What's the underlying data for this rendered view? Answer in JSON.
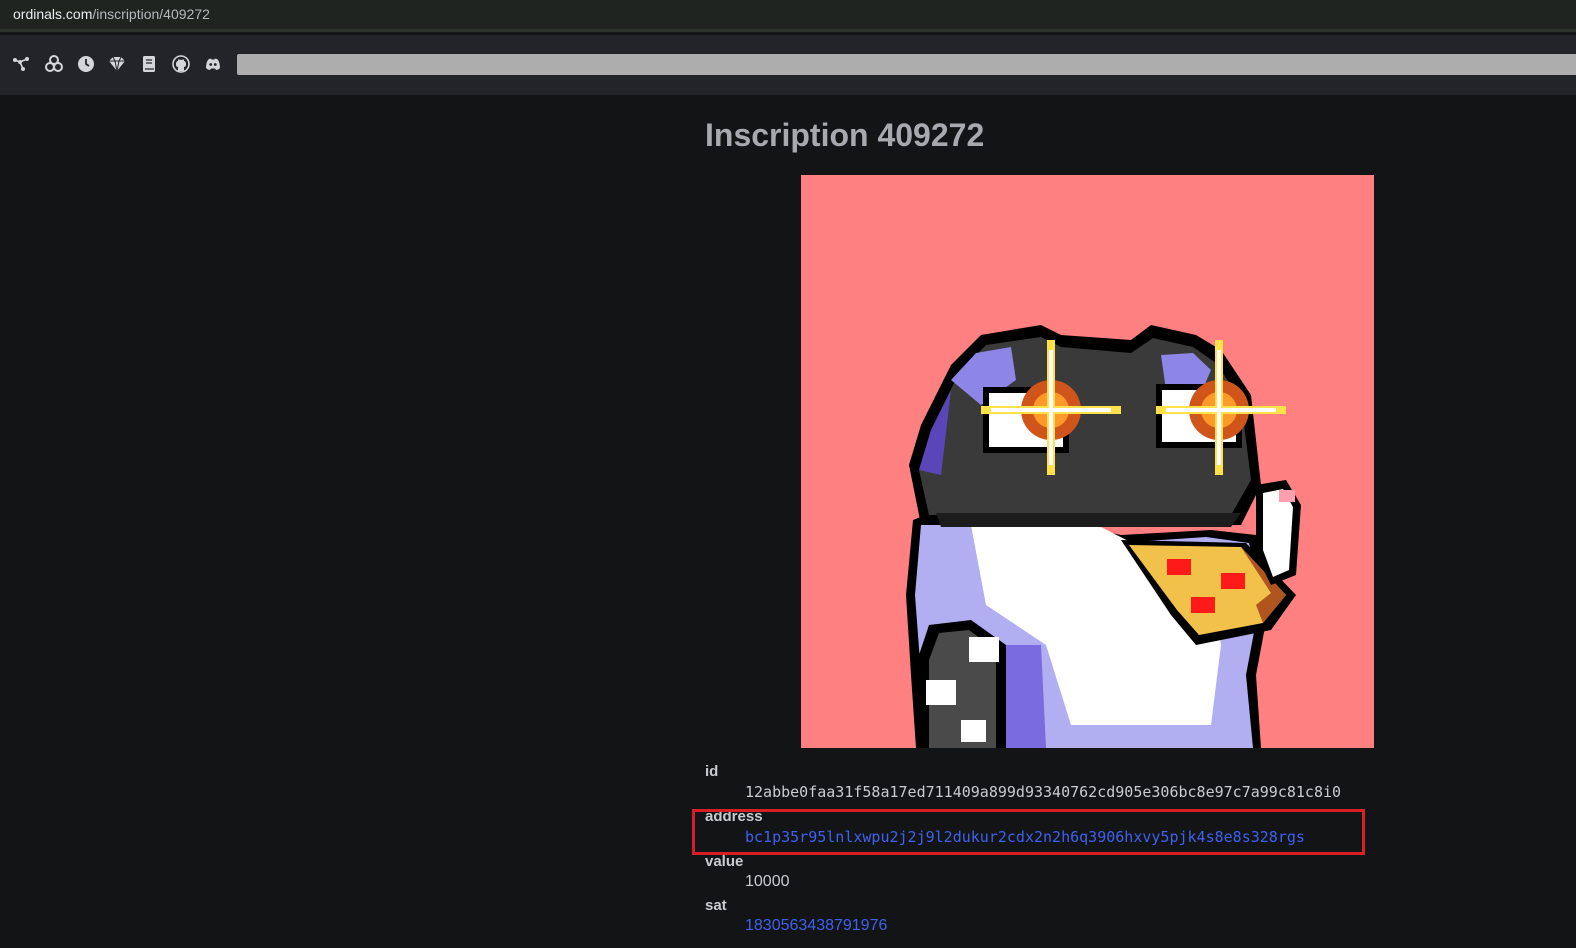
{
  "browser": {
    "url_host": "ordinals.com",
    "url_path": "/inscription/409272"
  },
  "nav": {
    "icons": [
      "blocks-icon",
      "rare-sats-icon",
      "clock-icon",
      "gem-icon",
      "book-icon",
      "github-icon",
      "discord-icon"
    ],
    "search_placeholder": ""
  },
  "page": {
    "title": "Inscription 409272",
    "preview_background": "#ff8080"
  },
  "properties": {
    "id_label": "id",
    "id_value": "12abbe0faa31f58a17ed711409a899d93340762cd905e306bc8e97c7a99c81c8i0",
    "address_label": "address",
    "address_value": "bc1p35r95lnlxwpu2j2j9l2dukur2cdx2n2h6q3906hxvy5pjk4s8e8s328rgs",
    "value_label": "value",
    "value_value": "10000",
    "sat_label": "sat",
    "sat_value": "1830563438791976"
  },
  "colors": {
    "link": "#3f61f0",
    "highlight": "#d71f25"
  }
}
